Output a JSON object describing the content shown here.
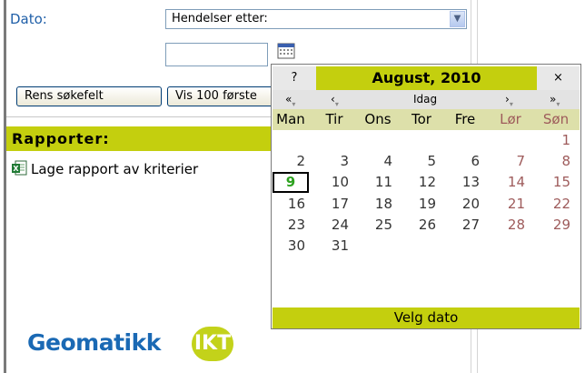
{
  "form": {
    "date_label": "Dato:",
    "date_filter_selected": "Hendelser etter:",
    "date_value": "",
    "clear_button": "Rens søkefelt",
    "show_button": "Vis 100 første"
  },
  "reports": {
    "header": "Rapporter:",
    "create_report_link": "Lage rapport av kriterier"
  },
  "logo": {
    "text": "Geomatikk",
    "badge": "IKT"
  },
  "calendar": {
    "help": "?",
    "title": "August, 2010",
    "close": "×",
    "nav": {
      "prev_year": "«",
      "prev_month": "‹",
      "today": "Idag",
      "next_month": "›",
      "next_year": "»"
    },
    "weekdays": [
      "Man",
      "Tir",
      "Ons",
      "Tor",
      "Fre",
      "Lør",
      "Søn"
    ],
    "weeks": [
      [
        "",
        "",
        "",
        "",
        "",
        "",
        "1"
      ],
      [
        "2",
        "3",
        "4",
        "5",
        "6",
        "7",
        "8"
      ],
      [
        "9",
        "10",
        "11",
        "12",
        "13",
        "14",
        "15"
      ],
      [
        "16",
        "17",
        "18",
        "19",
        "20",
        "21",
        "22"
      ],
      [
        "23",
        "24",
        "25",
        "26",
        "27",
        "28",
        "29"
      ],
      [
        "30",
        "31",
        "",
        "",
        "",
        "",
        ""
      ]
    ],
    "selected_day": "9",
    "footer": "Velg dato"
  },
  "colors": {
    "accent": "#c4cf0e",
    "link_blue": "#1f5fa8",
    "weekend": "#9e5b5b",
    "today": "#2da11f"
  }
}
